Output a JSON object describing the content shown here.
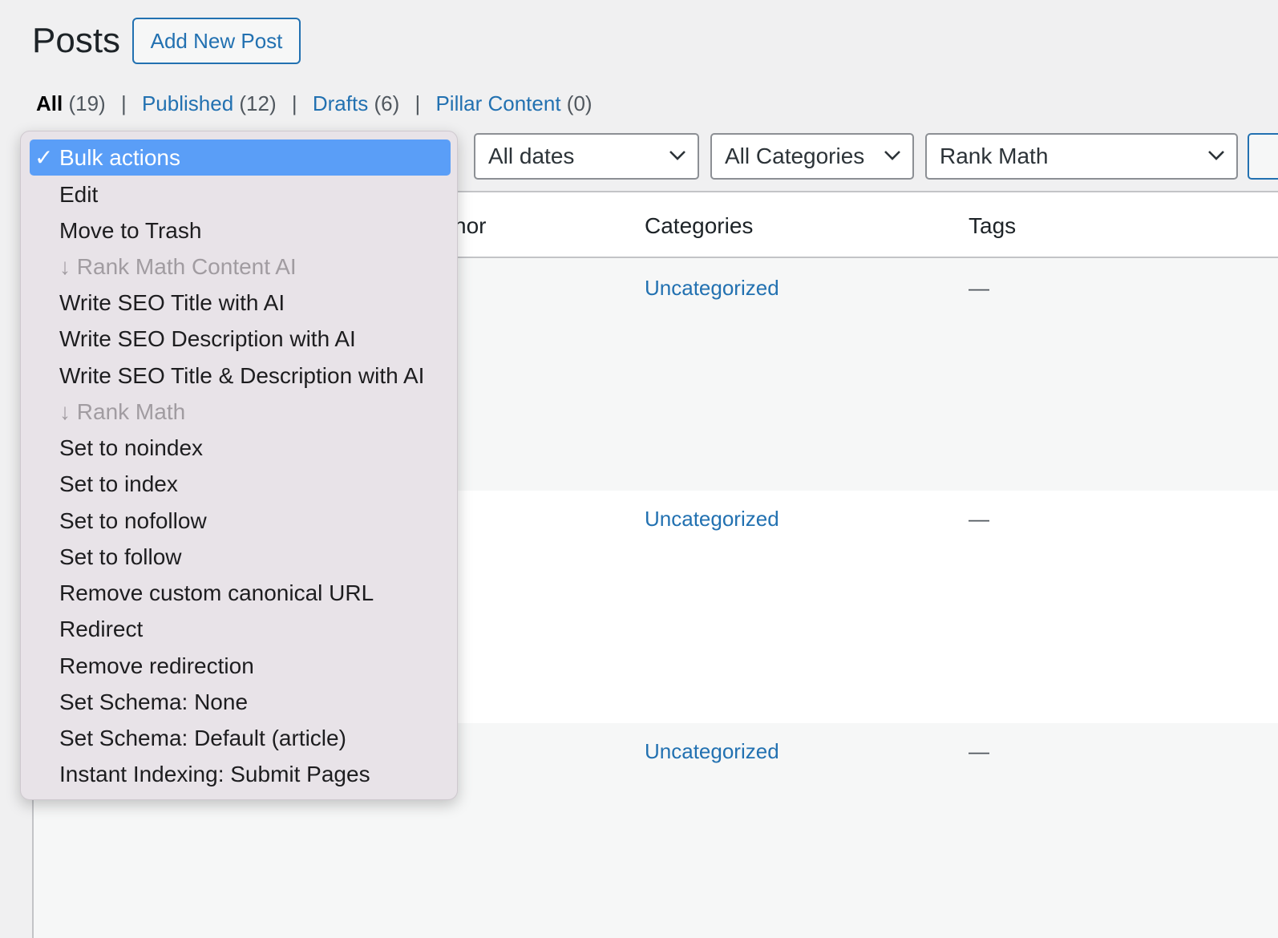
{
  "header": {
    "title": "Posts",
    "add_new_label": "Add New Post"
  },
  "views": {
    "all_label": "All",
    "all_count": "(19)",
    "published_label": "Published",
    "published_count": "(12)",
    "drafts_label": "Drafts",
    "drafts_count": "(6)",
    "pillar_label": "Pillar Content",
    "pillar_count": "(0)",
    "separator": "|"
  },
  "filters": {
    "dates": "All dates",
    "categories": "All Categories",
    "seo": "Rank Math"
  },
  "table": {
    "columns": {
      "author_partial": "hor",
      "categories": "Categories",
      "tags": "Tags"
    },
    "rows": [
      {
        "category": "Uncategorized",
        "tags": "—"
      },
      {
        "category": "Uncategorized",
        "tags": "—"
      },
      {
        "category": "Uncategorized",
        "tags": "—"
      }
    ]
  },
  "bulk_dropdown": {
    "check": "✓",
    "items": [
      {
        "label": "Bulk actions",
        "state": "selected"
      },
      {
        "label": "Edit",
        "state": "normal"
      },
      {
        "label": "Move to Trash",
        "state": "normal"
      },
      {
        "label": "↓ Rank Math Content AI",
        "state": "disabled"
      },
      {
        "label": "Write SEO Title with AI",
        "state": "normal"
      },
      {
        "label": "Write SEO Description with AI",
        "state": "normal"
      },
      {
        "label": "Write SEO Title & Description with AI",
        "state": "normal"
      },
      {
        "label": "↓ Rank Math",
        "state": "disabled"
      },
      {
        "label": "Set to noindex",
        "state": "normal"
      },
      {
        "label": "Set to index",
        "state": "normal"
      },
      {
        "label": "Set to nofollow",
        "state": "normal"
      },
      {
        "label": "Set to follow",
        "state": "normal"
      },
      {
        "label": "Remove custom canonical URL",
        "state": "normal"
      },
      {
        "label": "Redirect",
        "state": "normal"
      },
      {
        "label": "Remove redirection",
        "state": "normal"
      },
      {
        "label": "Set Schema: None",
        "state": "normal"
      },
      {
        "label": "Set Schema: Default (article)",
        "state": "normal"
      },
      {
        "label": "Instant Indexing: Submit Pages",
        "state": "normal"
      }
    ]
  },
  "colors": {
    "link": "#2271b1",
    "selected_bg": "#5a9ef7",
    "menu_bg": "#e8e3e8"
  }
}
